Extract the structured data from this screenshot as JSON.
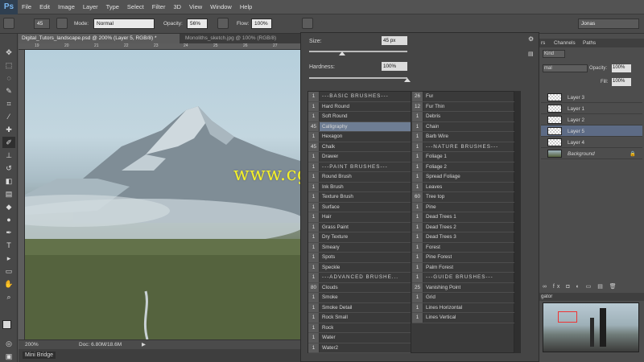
{
  "app": {
    "logo": "Ps"
  },
  "menu": [
    "File",
    "Edit",
    "Image",
    "Layer",
    "Type",
    "Select",
    "Filter",
    "3D",
    "View",
    "Window",
    "Help"
  ],
  "options": {
    "brush_size": "45",
    "mode_label": "Mode:",
    "mode_value": "Normal",
    "opacity_label": "Opacity:",
    "opacity_value": "56%",
    "flow_label": "Flow:",
    "flow_value": "100%",
    "workspace": "Jonas"
  },
  "doc_tabs": [
    {
      "label": "Digital_Tutors_landscape.psd @ 200% (Layer 5, RGB/8) *"
    },
    {
      "label": "Monoliths_sketch.jpg @ 100% (RGB/8)"
    }
  ],
  "ruler_ticks": [
    "19",
    "20",
    "21",
    "22",
    "23",
    "24",
    "25",
    "26",
    "27",
    "28"
  ],
  "status": {
    "zoom": "200%",
    "doc": "Doc: 6.80M/18.6M"
  },
  "mini_bridge": "Mini Bridge",
  "picker": {
    "size_label": "Size:",
    "size_value": "45 px",
    "size_fraction": 0.34,
    "hardness_label": "Hardness:",
    "hardness_value": "100%",
    "hardness_fraction": 1.0
  },
  "brushes_col1": [
    {
      "num": "1",
      "name": "---BASIC BRUSHES---",
      "header": true
    },
    {
      "num": "1",
      "name": "Hard Round"
    },
    {
      "num": "1",
      "name": "Soft Round"
    },
    {
      "num": "45",
      "name": "Calligraphy",
      "selected": true
    },
    {
      "num": "1",
      "name": "Hexagon"
    },
    {
      "num": "45",
      "name": "Chalk"
    },
    {
      "num": "1",
      "name": "Drawer"
    },
    {
      "num": "1",
      "name": "---PAINT BRUSHES---",
      "header": true
    },
    {
      "num": "1",
      "name": "Round Brush"
    },
    {
      "num": "1",
      "name": "Ink Brush"
    },
    {
      "num": "1",
      "name": "Texture Brush"
    },
    {
      "num": "1",
      "name": "Surface"
    },
    {
      "num": "1",
      "name": "Hair"
    },
    {
      "num": "1",
      "name": "Grass Paint"
    },
    {
      "num": "1",
      "name": "Dry Texture"
    },
    {
      "num": "1",
      "name": "Smeary"
    },
    {
      "num": "1",
      "name": "Spots"
    },
    {
      "num": "1",
      "name": "Speckle"
    },
    {
      "num": "1",
      "name": "---ADVANCED BRUSHE...",
      "header": true
    },
    {
      "num": "80",
      "name": "Clouds"
    },
    {
      "num": "1",
      "name": "Smoke"
    },
    {
      "num": "1",
      "name": "Smoke Detail"
    },
    {
      "num": "1",
      "name": "Rock Small"
    },
    {
      "num": "1",
      "name": "Rock"
    },
    {
      "num": "1",
      "name": "Water"
    },
    {
      "num": "1",
      "name": "Water2"
    }
  ],
  "brushes_col2": [
    {
      "num": "26",
      "name": "Fur"
    },
    {
      "num": "12",
      "name": "Fur Thin"
    },
    {
      "num": "1",
      "name": "Debris"
    },
    {
      "num": "1",
      "name": "Chain"
    },
    {
      "num": "1",
      "name": "Barb Wire"
    },
    {
      "num": "1",
      "name": "---NATURE BRUSHES---",
      "header": true
    },
    {
      "num": "1",
      "name": "Foliage 1"
    },
    {
      "num": "1",
      "name": "Foliage 2"
    },
    {
      "num": "1",
      "name": "Spread Foliage"
    },
    {
      "num": "1",
      "name": "Leaves"
    },
    {
      "num": "60",
      "name": "Tree top"
    },
    {
      "num": "1",
      "name": "Pine"
    },
    {
      "num": "1",
      "name": "Dead Trees 1"
    },
    {
      "num": "1",
      "name": "Dead Trees 2"
    },
    {
      "num": "1",
      "name": "Dead Trees 3"
    },
    {
      "num": "1",
      "name": "Forest"
    },
    {
      "num": "1",
      "name": "Pine Forest"
    },
    {
      "num": "1",
      "name": "Palm Forest"
    },
    {
      "num": "1",
      "name": "---GUIDE BRUSHES---",
      "header": true
    },
    {
      "num": "25",
      "name": "Vanishing Point"
    },
    {
      "num": "1",
      "name": "Grid"
    },
    {
      "num": "1",
      "name": "Lines Horizontal"
    },
    {
      "num": "1",
      "name": "Lines Vertical"
    }
  ],
  "panels": {
    "tabs": [
      "rs",
      "Channels",
      "Paths"
    ],
    "kind": "Kind",
    "blend": "mal",
    "opacity_label": "Opacity:",
    "opacity_value": "100%",
    "fill_label": "Fill:",
    "fill_value": "100%",
    "layers": [
      {
        "name": "Layer 3"
      },
      {
        "name": "Layer 1"
      },
      {
        "name": "Layer 2"
      },
      {
        "name": "Layer 5",
        "selected": true
      },
      {
        "name": "Layer 4"
      },
      {
        "name": "Background",
        "italic": true
      }
    ],
    "navigator_tab": "gator"
  },
  "watermark": "www.cgtsj.com"
}
